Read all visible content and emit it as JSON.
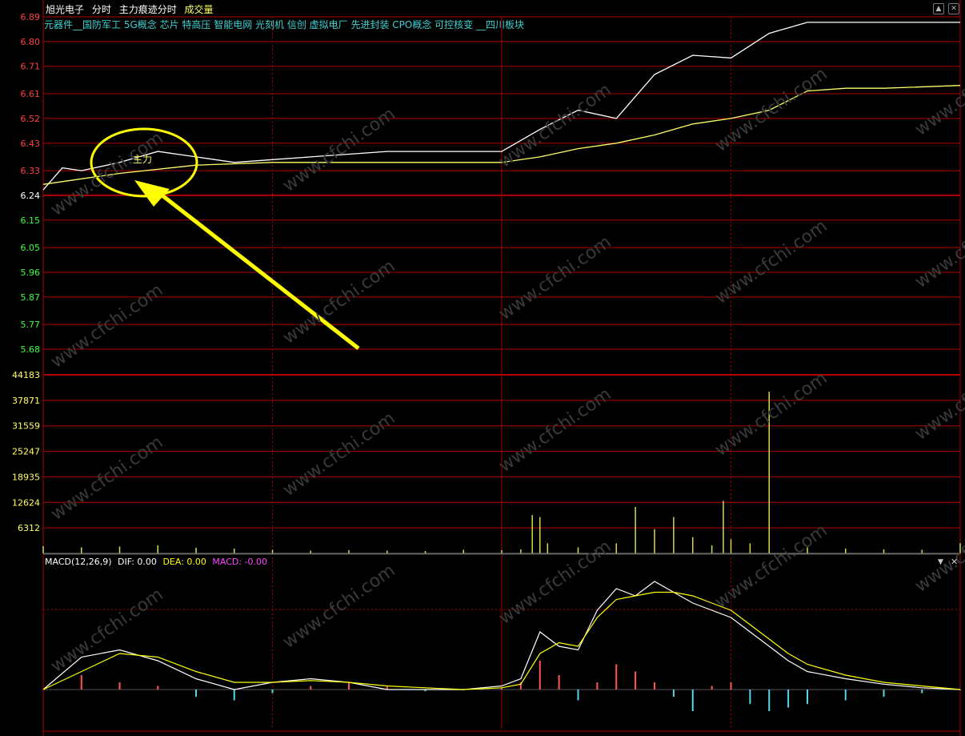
{
  "header": {
    "stock_name": "旭光电子",
    "mode": "分时",
    "indicator": "主力痕迹分时",
    "volume_label": "成交量"
  },
  "concept_tags": "元器件__国防军工 5G概念 芯片 特高压 智能电网 光刻机 信创 虚拟电厂 先进封装 CPO概念 可控核变 __四川板块",
  "annotation": {
    "text": "主力"
  },
  "macd_header": {
    "name": "MACD(12,26,9)",
    "dif": "DIF: 0.00",
    "dea": "DEA: 0.00",
    "macd": "MACD: -0.00"
  },
  "watermark": "www.cfchi.com",
  "colors": {
    "price_up": "#ff4040",
    "price_down": "#3cff3c",
    "grid": "#b00000",
    "price_line": "#ffffff",
    "avg_line": "#ffff66",
    "volume_bar": "#d8d84a",
    "macd_pos": "#ff5555",
    "macd_neg": "#55d6e6",
    "tags": "#3fd0d0",
    "dea": "#ffff00",
    "macd_label": "#ff44ff"
  },
  "chart_data": [
    {
      "type": "line",
      "title": "分时",
      "y_ticks": [
        "6.89",
        "6.80",
        "6.71",
        "6.61",
        "6.52",
        "6.43",
        "6.33",
        "6.24",
        "6.15",
        "6.05",
        "5.96",
        "5.87",
        "5.77",
        "5.68"
      ],
      "prev_close": 6.24,
      "ylim": [
        5.68,
        6.89
      ],
      "series": [
        {
          "name": "price",
          "x": [
            0,
            5,
            10,
            20,
            30,
            40,
            50,
            60,
            70,
            80,
            90,
            100,
            110,
            120,
            130,
            140,
            150,
            160,
            170,
            180,
            190,
            200,
            210,
            220,
            230,
            240
          ],
          "values": [
            6.26,
            6.34,
            6.33,
            6.36,
            6.4,
            6.38,
            6.36,
            6.37,
            6.38,
            6.39,
            6.4,
            6.4,
            6.4,
            6.4,
            6.48,
            6.55,
            6.52,
            6.68,
            6.75,
            6.74,
            6.83,
            6.87,
            6.87,
            6.87,
            6.87,
            6.87
          ]
        },
        {
          "name": "avg",
          "x": [
            0,
            20,
            40,
            60,
            80,
            100,
            120,
            130,
            140,
            150,
            160,
            170,
            180,
            190,
            200,
            210,
            220,
            240
          ],
          "values": [
            6.28,
            6.32,
            6.35,
            6.36,
            6.36,
            6.36,
            6.36,
            6.38,
            6.41,
            6.43,
            6.46,
            6.5,
            6.52,
            6.55,
            6.62,
            6.63,
            6.63,
            6.64
          ]
        }
      ]
    },
    {
      "type": "bar",
      "title": "成交量",
      "y_ticks": [
        "44183",
        "37871",
        "31559",
        "25247",
        "18935",
        "12624",
        "6312"
      ],
      "ylim": [
        0,
        44183
      ],
      "x": [
        0,
        10,
        20,
        30,
        40,
        50,
        60,
        70,
        80,
        90,
        100,
        110,
        120,
        125,
        128,
        130,
        132,
        140,
        150,
        155,
        160,
        165,
        170,
        175,
        178,
        180,
        185,
        190,
        200,
        210,
        220,
        230,
        240
      ],
      "values": [
        1800,
        1500,
        1700,
        2000,
        1400,
        1200,
        900,
        700,
        800,
        700,
        600,
        900,
        800,
        1000,
        9500,
        9000,
        2500,
        1500,
        2500,
        11500,
        6000,
        9000,
        4000,
        2000,
        13000,
        3500,
        2500,
        40000,
        1500,
        1200,
        1000,
        900,
        2500
      ]
    },
    {
      "type": "bar",
      "title": "MACD(12,26,9)",
      "x": [
        0,
        10,
        20,
        30,
        40,
        50,
        60,
        70,
        80,
        90,
        100,
        110,
        120,
        125,
        130,
        135,
        140,
        145,
        150,
        155,
        160,
        165,
        170,
        175,
        180,
        185,
        190,
        195,
        200,
        210,
        220,
        230,
        240
      ],
      "values": [
        0.0,
        0.4,
        0.2,
        0.1,
        -0.2,
        -0.3,
        -0.1,
        0.1,
        0.2,
        0.1,
        -0.05,
        -0.02,
        0.05,
        0.2,
        0.8,
        0.4,
        -0.3,
        0.2,
        0.7,
        0.5,
        0.2,
        -0.2,
        -0.6,
        0.1,
        0.2,
        -0.4,
        -0.6,
        -0.5,
        -0.4,
        -0.3,
        -0.2,
        -0.1,
        -0.02
      ],
      "dif": [
        0.0,
        0.9,
        1.1,
        0.8,
        0.3,
        0.0,
        0.2,
        0.3,
        0.2,
        0.0,
        0.0,
        0.0,
        0.1,
        0.3,
        1.6,
        1.2,
        1.1,
        2.2,
        2.8,
        2.6,
        3.0,
        2.7,
        2.4,
        2.2,
        2.0,
        1.6,
        1.2,
        0.8,
        0.5,
        0.3,
        0.15,
        0.05,
        0.0
      ],
      "dea": [
        0.0,
        0.5,
        1.0,
        0.9,
        0.5,
        0.2,
        0.2,
        0.25,
        0.2,
        0.1,
        0.05,
        0.0,
        0.05,
        0.15,
        1.0,
        1.3,
        1.2,
        2.0,
        2.5,
        2.6,
        2.7,
        2.7,
        2.6,
        2.4,
        2.2,
        1.8,
        1.4,
        1.0,
        0.7,
        0.4,
        0.2,
        0.1,
        0.0
      ]
    }
  ]
}
